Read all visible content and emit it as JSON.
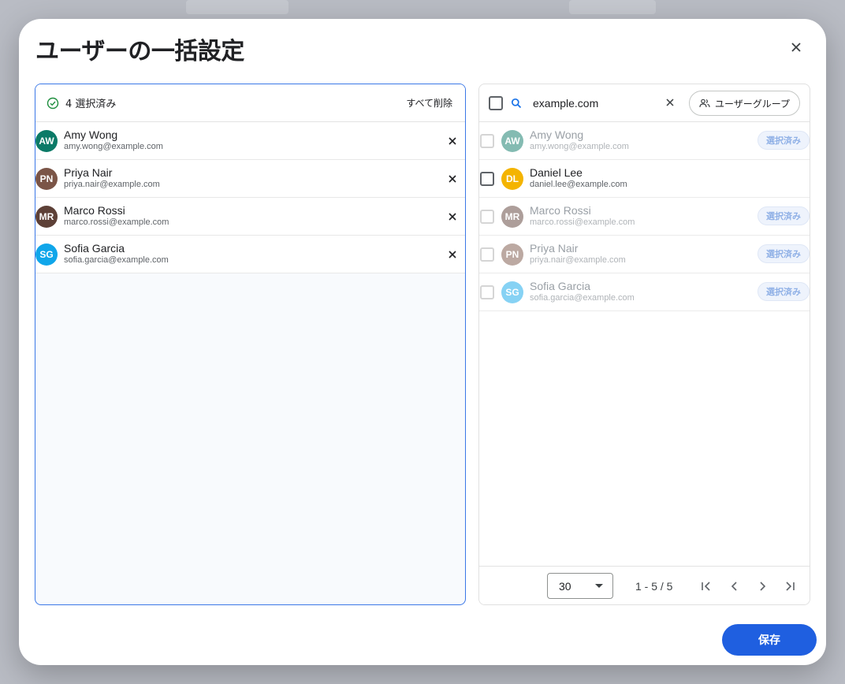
{
  "dialog": {
    "title": "ユーザーの一括設定",
    "close_icon": "close-icon",
    "save_label": "保存"
  },
  "selected_panel": {
    "count_text": "4 選択済み",
    "clear_all_label": "すべて削除",
    "items": [
      {
        "initials": "AW",
        "name": "Amy Wong",
        "email": "amy.wong@example.com",
        "color": "#0b7a67"
      },
      {
        "initials": "PN",
        "name": "Priya Nair",
        "email": "priya.nair@example.com",
        "color": "#7b5547"
      },
      {
        "initials": "MR",
        "name": "Marco Rossi",
        "email": "marco.rossi@example.com",
        "color": "#5d4037"
      },
      {
        "initials": "SG",
        "name": "Sofia Garcia",
        "email": "sofia.garcia@example.com",
        "color": "#10a6ea"
      }
    ]
  },
  "search_panel": {
    "search_value": "example.com",
    "group_button_label": "ユーザーグループ",
    "selected_chip_label": "選択済み",
    "results": [
      {
        "initials": "AW",
        "name": "Amy Wong",
        "email": "amy.wong@example.com",
        "color": "#0b7a67",
        "already_selected": true
      },
      {
        "initials": "DL",
        "name": "Daniel Lee",
        "email": "daniel.lee@example.com",
        "color": "#f4b400",
        "already_selected": false
      },
      {
        "initials": "MR",
        "name": "Marco Rossi",
        "email": "marco.rossi@example.com",
        "color": "#5d4037",
        "already_selected": true
      },
      {
        "initials": "PN",
        "name": "Priya Nair",
        "email": "priya.nair@example.com",
        "color": "#7b5547",
        "already_selected": true
      },
      {
        "initials": "SG",
        "name": "Sofia Garcia",
        "email": "sofia.garcia@example.com",
        "color": "#10a6ea",
        "already_selected": true
      }
    ],
    "pagination": {
      "page_size": "30",
      "range_text": "1 - 5 / 5"
    }
  },
  "colors": {
    "accent": "#1f5fe0",
    "selected_border": "#3b78e7",
    "check_green": "#1e8e3e"
  }
}
